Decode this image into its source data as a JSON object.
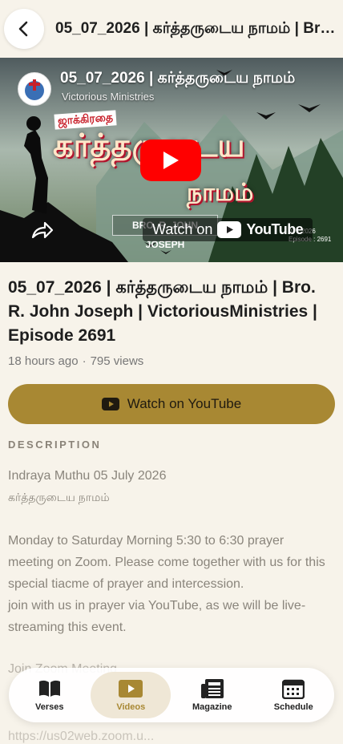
{
  "header": {
    "title": "05_07_2026 | கர்த்தருடைய நாமம் | Bro. R. John Joseph | VictoriousMinistries | Episode 2691"
  },
  "player": {
    "overlay_title": "05_07_2026 | கர்த்தருடைய நாமம்",
    "channel": "Victorious Ministries",
    "art_small": "ஜாக்கிரதை",
    "art_line1": "கர்த்தருடைய",
    "art_line2": "நாமம்",
    "speaker": "BRO. R. JOHN JOSEPH",
    "episode_tag_date": "07 - 2026",
    "episode_tag_num": "Episode : 2691",
    "watch_on_label": "Watch on",
    "youtube_word": "YouTube"
  },
  "video": {
    "title": "05_07_2026 | கர்த்தருடைய நாமம் | Bro. R. John Joseph | VictoriousMinistries | Episode 2691",
    "posted": "18 hours ago",
    "separator": "·",
    "views": "795 views"
  },
  "watch_button": {
    "label": "Watch on YouTube"
  },
  "description": {
    "section_label": "DESCRIPTION",
    "line1": "Indraya Muthu 05 July 2026",
    "line2": "கர்த்தருடைய நாமம்",
    "paragraph": "Monday to Saturday Morning 5:30 to 6:30 prayer meeting on Zoom. Please come together with us for this special tiacme of prayer and intercession.",
    "paragraph2": "join with us in prayer via YouTube, as we will be live-streaming this event.",
    "faded_line": "Join Zoom Meeting",
    "faded_link": "https://us02web.zoom.u..."
  },
  "tabs": [
    {
      "label": "Verses",
      "icon": "book-icon"
    },
    {
      "label": "Videos",
      "icon": "video-icon",
      "active": true
    },
    {
      "label": "Magazine",
      "icon": "newspaper-icon"
    },
    {
      "label": "Schedule",
      "icon": "calendar-icon"
    }
  ],
  "colors": {
    "background": "#f7f3ea",
    "accent": "#a88833",
    "youtube_red": "#ff0000"
  }
}
